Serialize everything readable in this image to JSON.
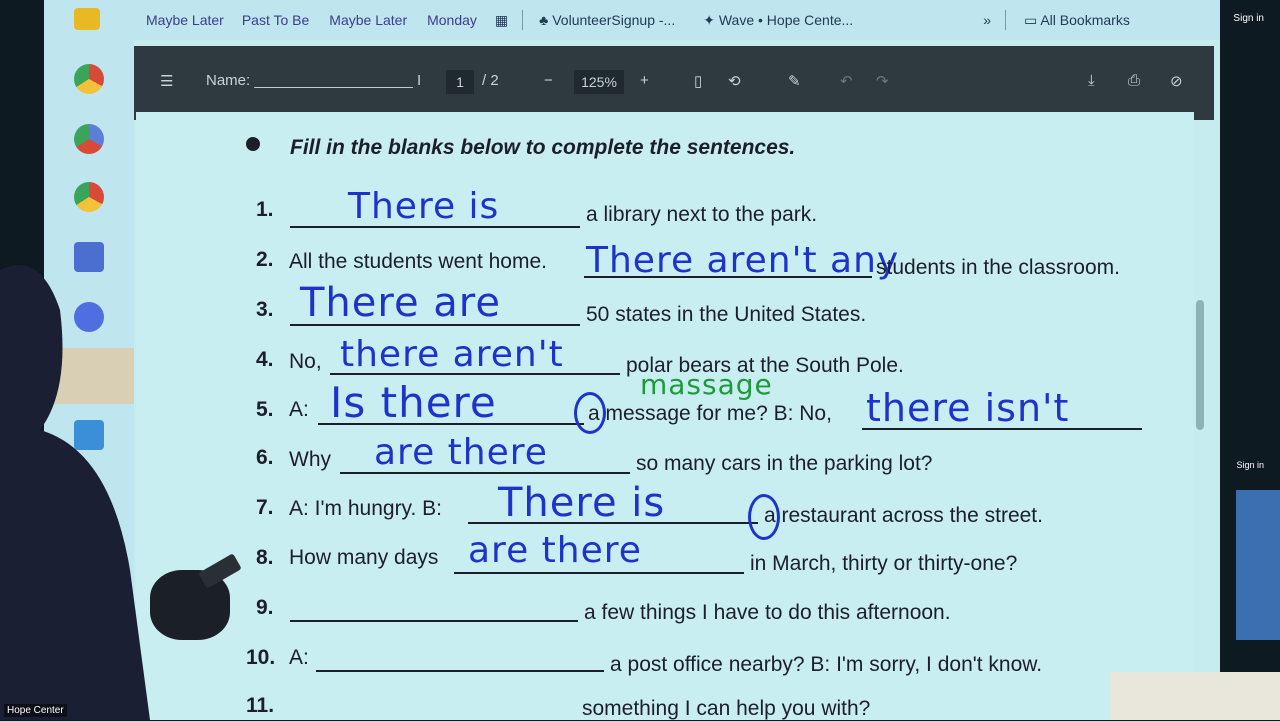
{
  "bookmarks": {
    "items": [
      "Maybe Later",
      "Past To Be",
      "Maybe Later",
      "Monday"
    ],
    "tab1": "VolunteerSignup -...",
    "tab2": "Wave • Hope Cente...",
    "more": "»",
    "all": "All Bookmarks"
  },
  "pdf": {
    "name_label": "Name: ___________________ I",
    "page_current": "1",
    "page_total": "/ 2",
    "zoom": "125%",
    "zoom_out": "−",
    "zoom_in": "+"
  },
  "worksheet": {
    "instructions": "Fill in the blanks below to complete the sentences.",
    "sentences": [
      {
        "num": "1.",
        "pre": "",
        "post": "a library next to the park.",
        "answer": "There is"
      },
      {
        "num": "2.",
        "pre": "All the students went home.",
        "post": "students in the classroom.",
        "answer": "There aren't any"
      },
      {
        "num": "3.",
        "pre": "",
        "post": "50 states in the United States.",
        "answer": "There are"
      },
      {
        "num": "4.",
        "pre": "No,",
        "post": "polar bears at the South Pole.",
        "answer": "there aren't"
      },
      {
        "num": "5.",
        "pre": "A:",
        "post": "a message for me?  B: No,",
        "answer": "Is there",
        "answer2": "there isn't",
        "note": "massage"
      },
      {
        "num": "6.",
        "pre": "Why",
        "post": "so many cars in the parking lot?",
        "answer": "are there"
      },
      {
        "num": "7.",
        "pre": "A: I'm hungry.  B:",
        "post": "a restaurant across the street.",
        "answer": "There is"
      },
      {
        "num": "8.",
        "pre": "How many days",
        "post": "in March, thirty or thirty-one?",
        "answer": "are there"
      },
      {
        "num": "9.",
        "pre": "",
        "post": "a few things I have to do this afternoon.",
        "answer": ""
      },
      {
        "num": "10.",
        "pre": "A:",
        "post": "a post office nearby?  B: I'm sorry, I don't know.",
        "answer": ""
      },
      {
        "num": "11.",
        "pre": "",
        "post": "something I can help you with?",
        "answer": ""
      }
    ]
  },
  "overlay": {
    "signin": "Sign in",
    "signin2": "Sign in",
    "camera_label": "Hope Center"
  },
  "colors": {
    "ink": "#1d33c9",
    "green_ink": "#1f9a3b",
    "toolbar": "#2e3a40"
  }
}
